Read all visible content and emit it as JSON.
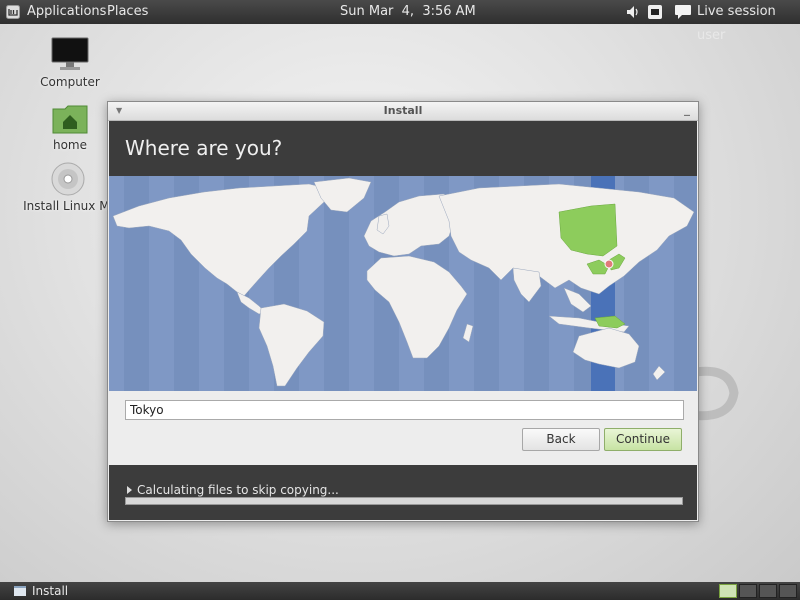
{
  "top_panel": {
    "menu_icon": "mint-logo-icon",
    "applications_label": "Applications",
    "places_label": "Places",
    "clock": "Sun Mar  4,  3:56 AM",
    "tray_icons": [
      "volume-icon",
      "network-icon",
      "chat-icon"
    ],
    "user_label": "Live session user"
  },
  "desktop": {
    "icons": [
      {
        "label": "Computer",
        "icon": "monitor-icon"
      },
      {
        "label": "home",
        "icon": "home-folder-icon"
      },
      {
        "label": "Install Linux Mi",
        "icon": "cd-icon"
      }
    ]
  },
  "window": {
    "title": "Install",
    "header_title": "Where are you?",
    "timezone_value": "Tokyo",
    "back_label": "Back",
    "continue_label": "Continue",
    "progress_text": "Calculating files to skip copying...",
    "progress_fraction": 0,
    "colors": {
      "map_ocean": "#7f98c5",
      "map_land": "#f2f0ee",
      "highlight_land": "#8dcc5c",
      "timezone_band": "#4a72b8"
    }
  },
  "bottom_panel": {
    "task_label": "Install",
    "task_icon": "window-icon",
    "workspaces": 4,
    "active_workspace": 1
  }
}
